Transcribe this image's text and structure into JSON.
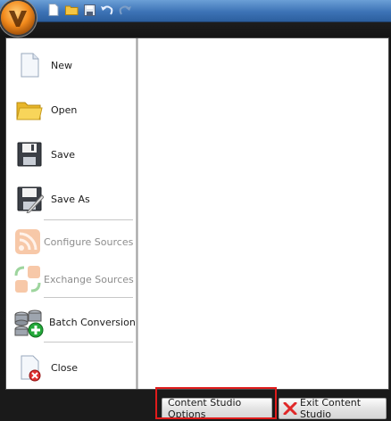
{
  "menu": {
    "items": [
      {
        "label": "New",
        "icon": "new-document-icon",
        "enabled": true
      },
      {
        "label": "Open",
        "icon": "open-folder-icon",
        "enabled": true
      },
      {
        "label": "Save",
        "icon": "floppy-disk-icon",
        "enabled": true
      },
      {
        "label": "Save As",
        "icon": "save-as-icon",
        "enabled": true
      },
      {
        "label": "Configure Sources",
        "icon": "rss-feed-icon",
        "enabled": false
      },
      {
        "label": "Exchange Sources",
        "icon": "exchange-feeds-icon",
        "enabled": false
      },
      {
        "label": "Batch Conversion",
        "icon": "database-add-icon",
        "enabled": true
      },
      {
        "label": "Close",
        "icon": "close-document-icon",
        "enabled": true
      }
    ]
  },
  "footer": {
    "options_label": "Content Studio Options",
    "exit_label": "Exit Content Studio"
  },
  "colors": {
    "highlight": "#e01b1b",
    "orb": "#f28a1c",
    "titlebar": "#3d73b6",
    "disabled_text": "#8d8d8d"
  }
}
